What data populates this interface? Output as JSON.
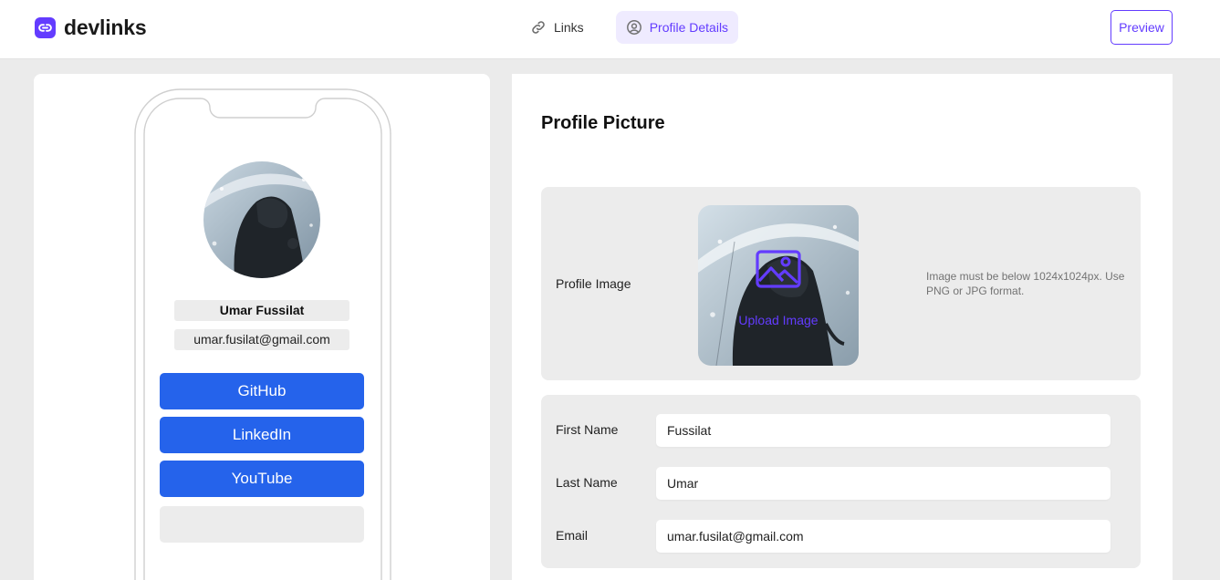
{
  "app": {
    "name": "devlinks",
    "brand_color": "#633cff",
    "logo_icon": "link-icon"
  },
  "nav": {
    "tabs": [
      {
        "label": "Links",
        "icon": "link-icon",
        "active": false
      },
      {
        "label": "Profile Details",
        "icon": "user-circle-icon",
        "active": true
      }
    ],
    "preview_label": "Preview"
  },
  "phone_preview": {
    "name": "Umar Fussilat",
    "email": "umar.fusilat@gmail.com",
    "links": [
      {
        "label": "GitHub",
        "color": "#2563eb"
      },
      {
        "label": "LinkedIn",
        "color": "#2563eb"
      },
      {
        "label": "YouTube",
        "color": "#2563eb"
      }
    ]
  },
  "profile_picture": {
    "title": "Profile Picture",
    "label": "Profile Image",
    "upload_label": "Upload Image",
    "upload_icon": "image-icon",
    "hint": "Image must be below 1024x1024px. Use PNG or JPG format."
  },
  "form": {
    "first_name": {
      "label": "First Name",
      "value": "Fussilat"
    },
    "last_name": {
      "label": "Last Name",
      "value": "Umar"
    },
    "email": {
      "label": "Email",
      "value": "umar.fusilat@gmail.com"
    }
  }
}
